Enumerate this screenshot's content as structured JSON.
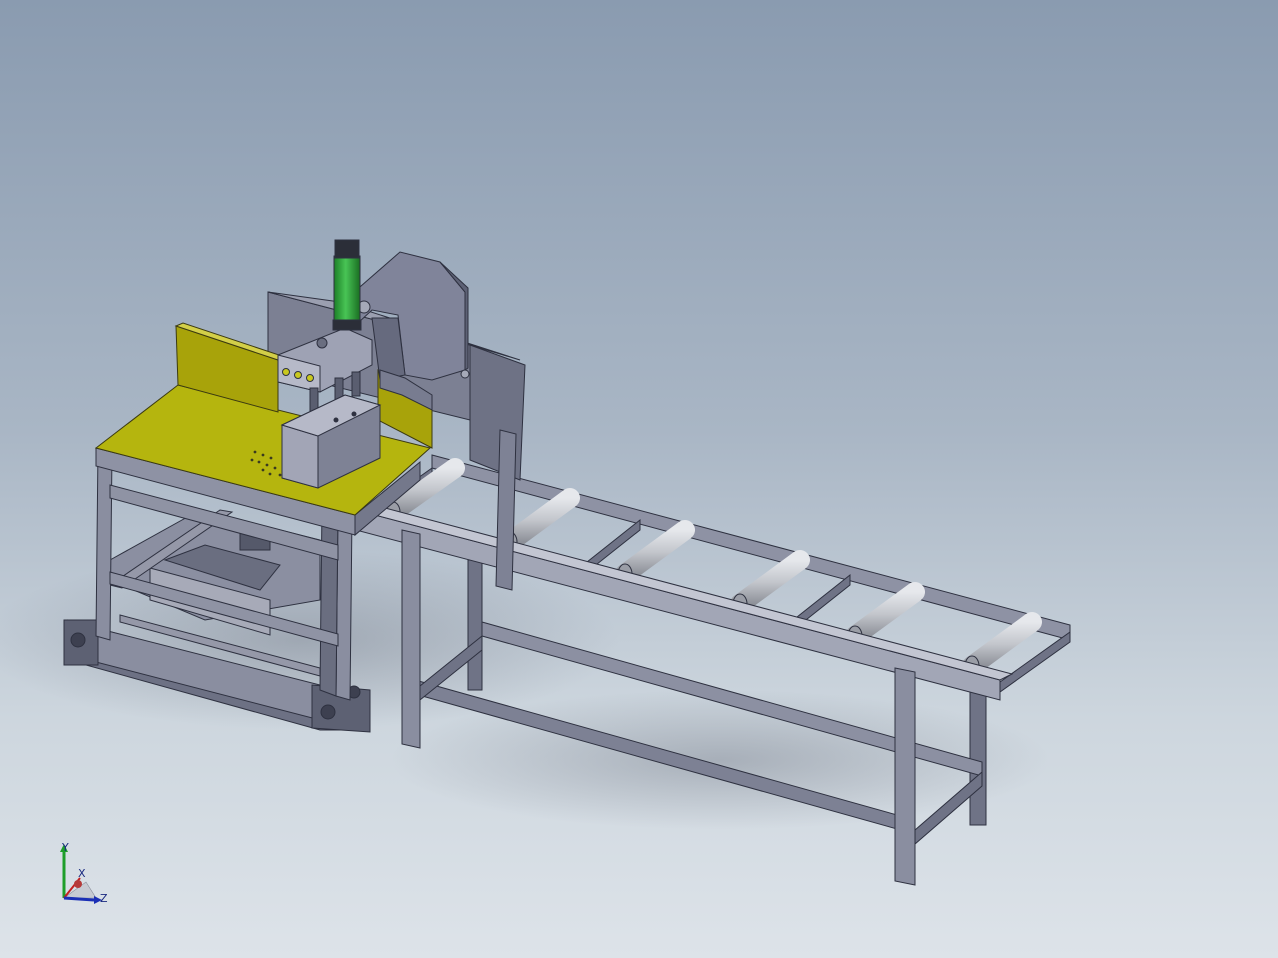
{
  "triad": {
    "x_label": "X",
    "y_label": "Y",
    "z_label": "Z"
  },
  "colors": {
    "background_top": "#8a9bb0",
    "background_bottom": "#dde3e9",
    "steel": "#7b7f92",
    "steel_light": "#a6a9b8",
    "steel_dark": "#4a4d5c",
    "table_top": "#b5b50e",
    "table_guard": "#a8a30a",
    "cylinder_green": "#2fa33a",
    "roller": "#c9ccd2",
    "axis_y": "#1e9e2a",
    "axis_x": "#c42020",
    "axis_z": "#1b2fb5"
  }
}
